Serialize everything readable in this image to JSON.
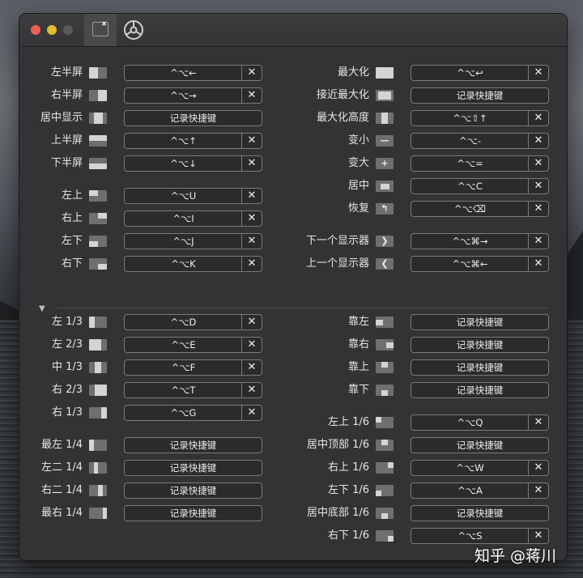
{
  "toolbar": {
    "window_tab": "window-shortcuts",
    "gear_tab": "general-preferences"
  },
  "left_top": [
    {
      "label": "左半屏",
      "shortcut": "^⌥←",
      "clear": true,
      "icon": "half-left"
    },
    {
      "label": "右半屏",
      "shortcut": "^⌥→",
      "clear": true,
      "icon": "half-right"
    },
    {
      "label": "居中显示",
      "shortcut": "记录快捷键",
      "clear": false,
      "icon": "center-half"
    },
    {
      "label": "上半屏",
      "shortcut": "^⌥↑",
      "clear": true,
      "icon": "half-top"
    },
    {
      "label": "下半屏",
      "shortcut": "^⌥↓",
      "clear": true,
      "icon": "half-bottom"
    },
    {
      "label": "左上",
      "shortcut": "^⌥U",
      "clear": true,
      "icon": "q-tl"
    },
    {
      "label": "右上",
      "shortcut": "^⌥I",
      "clear": true,
      "icon": "q-tr"
    },
    {
      "label": "左下",
      "shortcut": "^⌥J",
      "clear": true,
      "icon": "q-bl"
    },
    {
      "label": "右下",
      "shortcut": "^⌥K",
      "clear": true,
      "icon": "q-br"
    }
  ],
  "right_top": [
    {
      "label": "最大化",
      "shortcut": "^⌥↩",
      "clear": true,
      "icon": "max"
    },
    {
      "label": "接近最大化",
      "shortcut": "记录快捷键",
      "clear": false,
      "icon": "almost-max"
    },
    {
      "label": "最大化高度",
      "shortcut": "^⌥⇧↑",
      "clear": true,
      "icon": "max-height"
    },
    {
      "label": "变小",
      "shortcut": "^⌥-",
      "clear": true,
      "icon": "smaller"
    },
    {
      "label": "变大",
      "shortcut": "^⌥=",
      "clear": true,
      "icon": "larger"
    },
    {
      "label": "居中",
      "shortcut": "^⌥C",
      "clear": true,
      "icon": "center"
    },
    {
      "label": "恢复",
      "shortcut": "^⌥⌫",
      "clear": true,
      "icon": "restore"
    },
    {
      "label": "下一个显示器",
      "shortcut": "^⌥⌘→",
      "clear": true,
      "icon": "next-display"
    },
    {
      "label": "上一个显示器",
      "shortcut": "^⌥⌘←",
      "clear": true,
      "icon": "prev-display"
    }
  ],
  "left_bottom": [
    {
      "label": "左 1/3",
      "shortcut": "^⌥D",
      "clear": true,
      "icon": "third-left"
    },
    {
      "label": "左 2/3",
      "shortcut": "^⌥E",
      "clear": true,
      "icon": "twothird-left"
    },
    {
      "label": "中 1/3",
      "shortcut": "^⌥F",
      "clear": true,
      "icon": "third-center"
    },
    {
      "label": "右 2/3",
      "shortcut": "^⌥T",
      "clear": true,
      "icon": "twothird-right"
    },
    {
      "label": "右 1/3",
      "shortcut": "^⌥G",
      "clear": true,
      "icon": "third-right"
    },
    {
      "label": "最左 1/4",
      "shortcut": "记录快捷键",
      "clear": false,
      "icon": "fourth-1"
    },
    {
      "label": "左二 1/4",
      "shortcut": "记录快捷键",
      "clear": false,
      "icon": "fourth-2"
    },
    {
      "label": "右二 1/4",
      "shortcut": "记录快捷键",
      "clear": false,
      "icon": "fourth-3"
    },
    {
      "label": "最右 1/4",
      "shortcut": "记录快捷键",
      "clear": false,
      "icon": "fourth-4"
    }
  ],
  "right_bottom": [
    {
      "label": "靠左",
      "shortcut": "记录快捷键",
      "clear": false,
      "icon": "move-left"
    },
    {
      "label": "靠右",
      "shortcut": "记录快捷键",
      "clear": false,
      "icon": "move-right"
    },
    {
      "label": "靠上",
      "shortcut": "记录快捷键",
      "clear": false,
      "icon": "move-up"
    },
    {
      "label": "靠下",
      "shortcut": "记录快捷键",
      "clear": false,
      "icon": "move-down"
    },
    {
      "label": "左上 1/6",
      "shortcut": "^⌥Q",
      "clear": true,
      "icon": "sixth-tl"
    },
    {
      "label": "居中顶部 1/6",
      "shortcut": "记录快捷键",
      "clear": false,
      "icon": "sixth-tc"
    },
    {
      "label": "右上 1/6",
      "shortcut": "^⌥W",
      "clear": true,
      "icon": "sixth-tr"
    },
    {
      "label": "左下 1/6",
      "shortcut": "^⌥A",
      "clear": true,
      "icon": "sixth-bl"
    },
    {
      "label": "居中底部 1/6",
      "shortcut": "记录快捷键",
      "clear": false,
      "icon": "sixth-bc"
    },
    {
      "label": "右下 1/6",
      "shortcut": "^⌥S",
      "clear": true,
      "icon": "sixth-br"
    }
  ],
  "clear_glyph": "✕",
  "disclosure_glyph": "▼",
  "watermark": "知乎 @蒋川",
  "colors": {
    "accent": "#ec5f57",
    "window_bg": "#333335",
    "field_border": "#7a7a7c"
  }
}
